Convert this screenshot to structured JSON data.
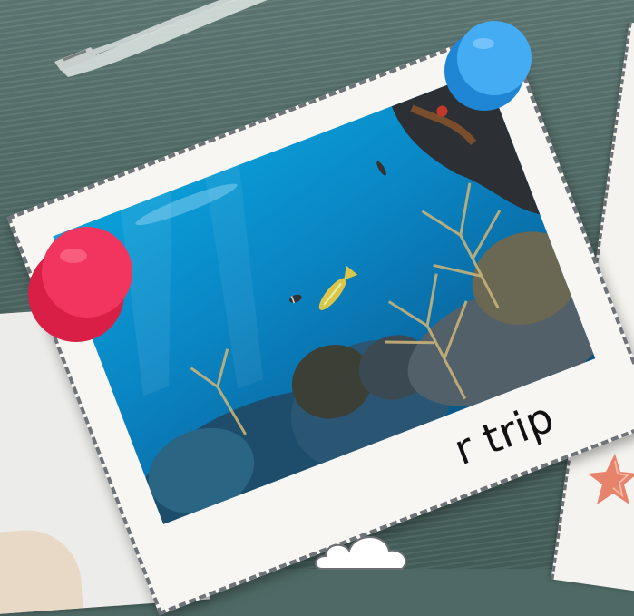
{
  "caption": {
    "text": "r trip"
  },
  "colors": {
    "pin_red": "#ef2a55",
    "pin_blue": "#3ea4ef",
    "sea": "#4f6a66",
    "paper": "#f7f6f2",
    "starfish": "#e7826b"
  },
  "icons": [
    "red-push-pin-icon",
    "blue-push-pin-icon",
    "starfish-icon",
    "cloud-icon"
  ]
}
